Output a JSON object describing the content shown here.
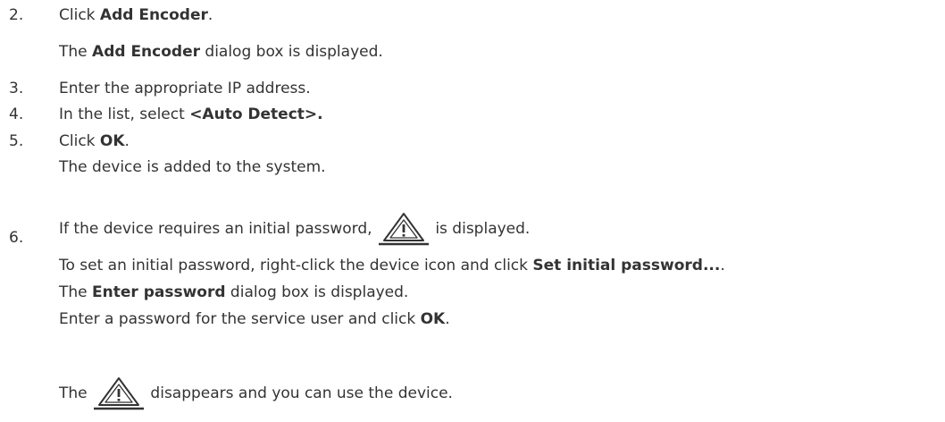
{
  "steps": [
    {
      "number": "2.",
      "pre": "Click ",
      "bold": "Add Encoder",
      "post": ".",
      "sub": {
        "pre": "The ",
        "bold": "Add Encoder",
        "post": " dialog box is displayed."
      }
    },
    {
      "number": "3.",
      "text": "Enter the appropriate IP address."
    },
    {
      "number": "4.",
      "pre": "In the list, select ",
      "bold": "<Auto Detect>."
    },
    {
      "number": "5.",
      "pre": "Click ",
      "bold": "OK",
      "post": ".",
      "sub": {
        "text": "The device is added to the system."
      }
    },
    {
      "number": "6.",
      "pre": "If the device requires an initial password, ",
      "post": " is displayed.",
      "icon": "warning-triangle-icon",
      "lines": [
        {
          "pre": "To set an initial password, right-click the device icon and click ",
          "bold": "Set initial password...",
          "post": "."
        },
        {
          "pre": "The ",
          "bold": "Enter password",
          "post": " dialog box is displayed."
        },
        {
          "pre": "Enter a password for the service user and click ",
          "bold": "OK",
          "post": "."
        },
        {
          "pre": "The ",
          "post": " disappears and you can use the device.",
          "icon": "warning-triangle-icon"
        }
      ]
    }
  ]
}
